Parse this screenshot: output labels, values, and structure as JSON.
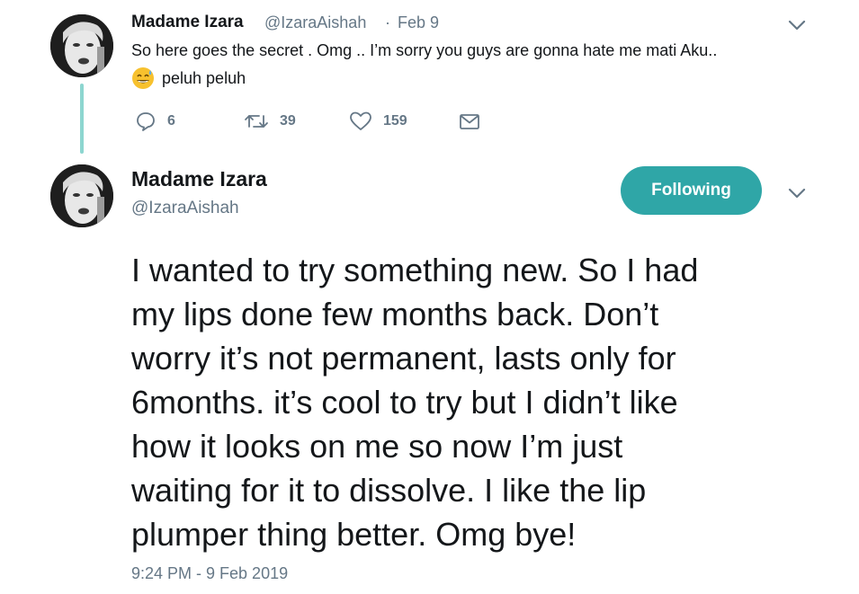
{
  "thread": {
    "reply_tweet": {
      "author_name": "Madame Izara",
      "author_handle": "@IzaraAishah",
      "separator": "·",
      "date": "Feb 9",
      "text_line1": "So here goes the secret . Omg .. I’m sorry you guys are gonna hate me mati Aku..",
      "emoji": "sweat-smile-emoji",
      "text_line2": "peluh peluh",
      "actions": {
        "replies": "6",
        "retweets": "39",
        "likes": "159"
      }
    },
    "main_tweet": {
      "author_name": "Madame Izara",
      "author_handle": "@IzaraAishah",
      "follow_label": "Following",
      "body_lines": [
        "I wanted to try something new. So I had",
        "my lips done few months back. Don’t",
        "worry it’s not permanent, lasts only for",
        "6months. it’s cool to try but I didn’t like",
        "how it looks on me so now I’m just",
        "waiting for it to dissolve. I like the lip",
        "plumper thing better. Omg bye!"
      ],
      "timestamp": "9:24 PM - 9 Feb 2019"
    }
  },
  "colors": {
    "accent": "#2fa6a7",
    "thread_line": "#8dd6d0",
    "muted_text": "#657786",
    "primary_text": "#14171a"
  }
}
